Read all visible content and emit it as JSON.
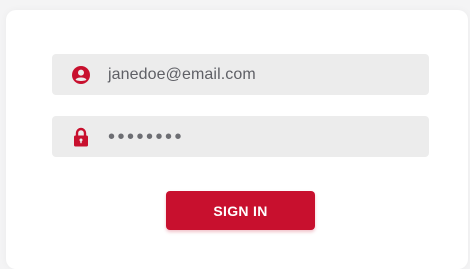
{
  "colors": {
    "accent": "#c8102e",
    "field_bg": "#ececec",
    "text": "#5f6066"
  },
  "email": {
    "value": "janedoe@email.com",
    "icon": "user-circle-icon"
  },
  "password": {
    "masked": "••••••••",
    "icon": "lock-icon"
  },
  "signin": {
    "label": "SIGN IN"
  }
}
